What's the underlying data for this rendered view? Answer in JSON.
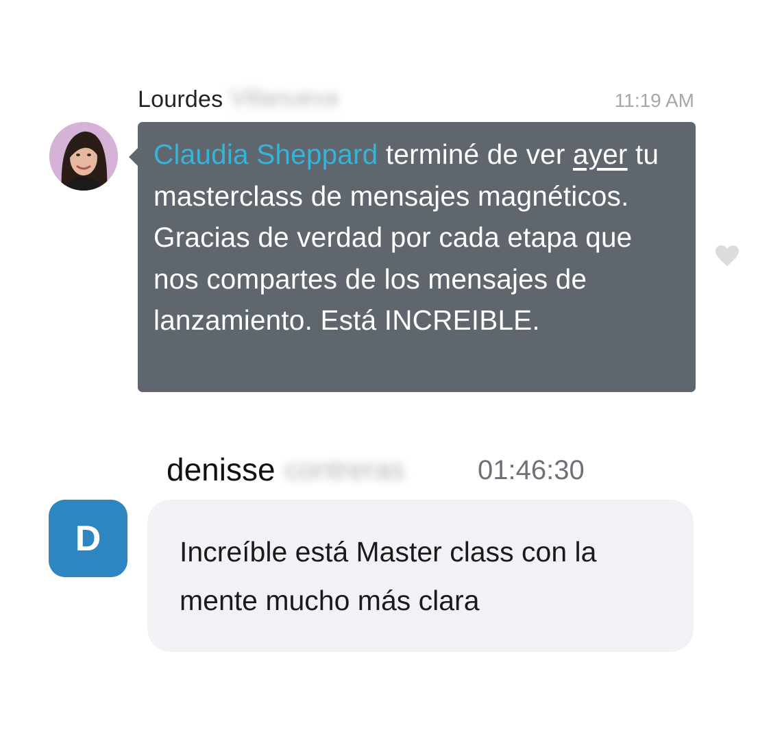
{
  "messages": [
    {
      "sender_first": "Lourdes",
      "sender_last": "Villanueva",
      "time": "11:19 AM",
      "mention": "Claudia Sheppard",
      "text_a": " terminé de ver ",
      "text_underlined": "ayer",
      "text_b": " tu masterclass de mensajes magnéticos. Gracias de verdad por cada etapa que nos compartes de los mensajes de lanzamiento. Está INCREIBLE.",
      "reaction_icon": "heart-icon"
    },
    {
      "sender_first": "denisse",
      "sender_last": "contreras",
      "time": "01:46:30",
      "avatar_letter": "D",
      "text": "Increíble está Master class con la mente mucho más clara"
    }
  ],
  "colors": {
    "dark_bubble": "#5f666e",
    "mention": "#36b3d6",
    "light_bubble": "#f1f1f6",
    "avatar_blue": "#2e86c1"
  }
}
